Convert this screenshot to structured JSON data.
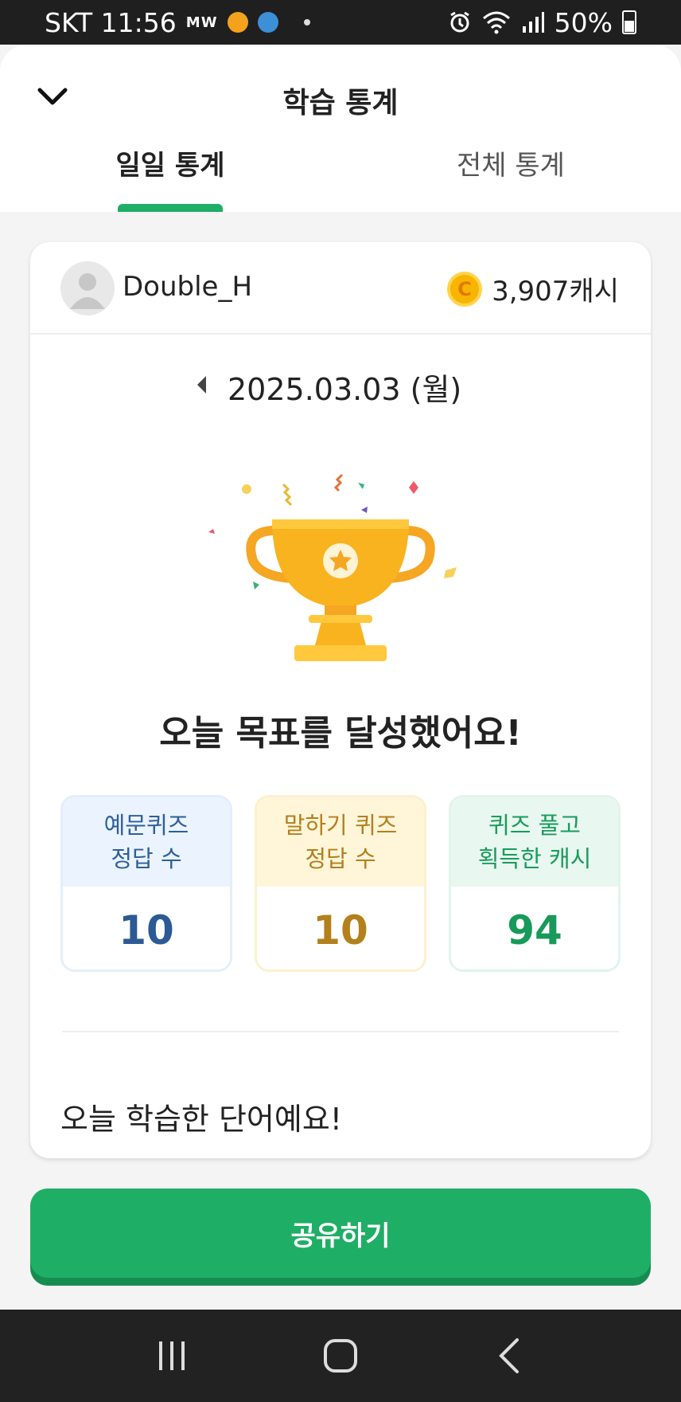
{
  "status_bar": {
    "carrier_time": "SKT 11:56",
    "mw_label": "MW",
    "battery": "50%"
  },
  "header": {
    "title": "학습 통계",
    "tabs": [
      {
        "label": "일일 통계",
        "active": true
      },
      {
        "label": "전체 통계",
        "active": false
      }
    ]
  },
  "profile": {
    "username": "Double_H",
    "cash": "3,907캐시",
    "coin_symbol": "C"
  },
  "date": "2025.03.03 (월)",
  "goal_message": "오늘 목표를 달성했어요!",
  "stats": [
    {
      "label_line1": "예문퀴즈",
      "label_line2": "정답 수",
      "value": "10",
      "color": "#2b5a94"
    },
    {
      "label_line1": "말하기 퀴즈",
      "label_line2": "정답 수",
      "value": "10",
      "color": "#b4801c"
    },
    {
      "label_line1": "퀴즈 풀고",
      "label_line2": "획득한 캐시",
      "value": "94",
      "color": "#189a5a"
    }
  ],
  "words_title": "오늘 학습한 단어예요!",
  "share_button": "공유하기",
  "colors": {
    "accent": "#1fae66",
    "trophy": "#f9b31f"
  }
}
